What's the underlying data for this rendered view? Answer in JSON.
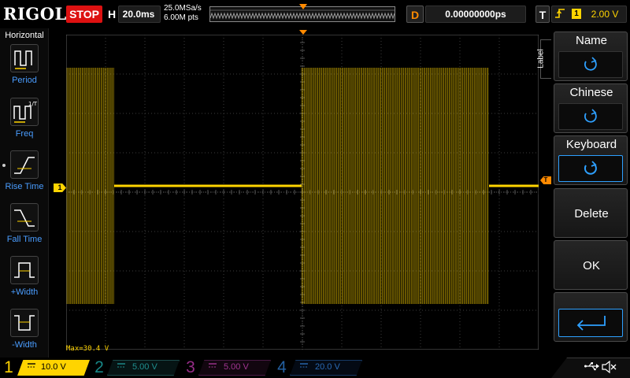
{
  "brand": "RIGOL",
  "top": {
    "run_status": "STOP",
    "horizontal_letter": "H",
    "timebase": "20.0ms",
    "sample_rate": "25.0MSa/s",
    "memory_depth": "6.00M pts",
    "delay_letter": "D",
    "delay_value": "0.00000000ps",
    "trigger_letter": "T",
    "trigger_source": "1",
    "trigger_level": "2.00 V"
  },
  "left_menu": {
    "title": "Horizontal",
    "items": [
      {
        "label": "Period",
        "icon": "period-measure-icon"
      },
      {
        "label": "Freq",
        "icon": "frequency-measure-icon"
      },
      {
        "label": "Rise Time",
        "icon": "rise-time-icon"
      },
      {
        "label": "Fall Time",
        "icon": "fall-time-icon"
      },
      {
        "label": "+Width",
        "icon": "positive-width-icon"
      },
      {
        "label": "-Width",
        "icon": "negative-width-icon"
      }
    ]
  },
  "screen": {
    "channel_marker": "1",
    "trigger_marker": "T",
    "max_readout": "Max=30.4 V"
  },
  "right_menu": {
    "tab_label": "Label",
    "buttons": [
      {
        "label": "Name",
        "icon": "rotate-knob-icon"
      },
      {
        "label": "Chinese",
        "icon": "rotate-knob-icon"
      },
      {
        "label": "Keyboard",
        "icon": "rotate-knob-icon"
      },
      {
        "label": "Delete"
      },
      {
        "label": "OK"
      },
      {
        "icon": "enter-return-icon"
      }
    ]
  },
  "channels": [
    {
      "num": "1",
      "scale": "10.0 V",
      "color": "#ffd400",
      "active": true
    },
    {
      "num": "2",
      "scale": "5.00 V",
      "color": "#1fb3b3",
      "active": false
    },
    {
      "num": "3",
      "scale": "5.00 V",
      "color": "#c83bb4",
      "active": false
    },
    {
      "num": "4",
      "scale": "20.0 V",
      "color": "#2f7fd6",
      "active": false
    }
  ],
  "colors": {
    "trace": "#ffd400",
    "trigger": "#ff8a00",
    "accent": "#2ea0ff",
    "stop": "#dd1111"
  },
  "status_icons": [
    "usb-icon",
    "speaker-muted-icon"
  ]
}
